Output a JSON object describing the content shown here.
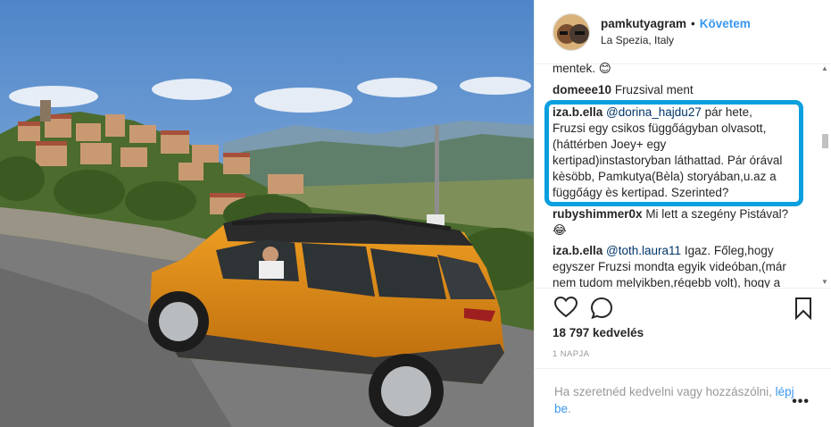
{
  "post": {
    "username": "pamkutyagram",
    "separator": "•",
    "follow_label": "Követem",
    "location": "La Spezia, Italy"
  },
  "comments": [
    {
      "text": "mentek. 😊"
    },
    {
      "user": "domeee10",
      "text": "Fruzsival ment"
    },
    {
      "user": "iza.b.ella",
      "mention": "@dorina_hajdu27",
      "text": "pár hete, Fruzsi egy csikos függőágyban olvasott,(háttérben Joey+ egy kertipad)instastoryban láthattad. Pár órával kèsöbb, Pamkutya(Bèla) storyában,u.az a függőágy ès kertipad. Szerinted?"
    },
    {
      "user": "rubyshimmer0x",
      "text": "Mi lett a szegény Pistával? 😂"
    },
    {
      "user": "iza.b.ella",
      "mention": "@toth.laura11",
      "text": "Igaz. Főleg,hogy egyszer Fruzsi mondta egyik videóban,(már nem tudom melyikben,régebb volt), hogy a"
    }
  ],
  "icons": {
    "like": "heart-icon",
    "comment": "comment-icon",
    "save": "bookmark-icon",
    "more": "more-options-icon"
  },
  "likes_label": "18 797 kedvelés",
  "time_label": "1 NAPJA",
  "footer": {
    "prompt": "Ha szeretnéd kedvelni vagy hozzászólni,",
    "login_label": "lépj be",
    "period": ".",
    "more_label": "•••"
  },
  "colors": {
    "accent": "#3897f0",
    "highlight": "#0a9fdf",
    "car": "#d98a14"
  }
}
